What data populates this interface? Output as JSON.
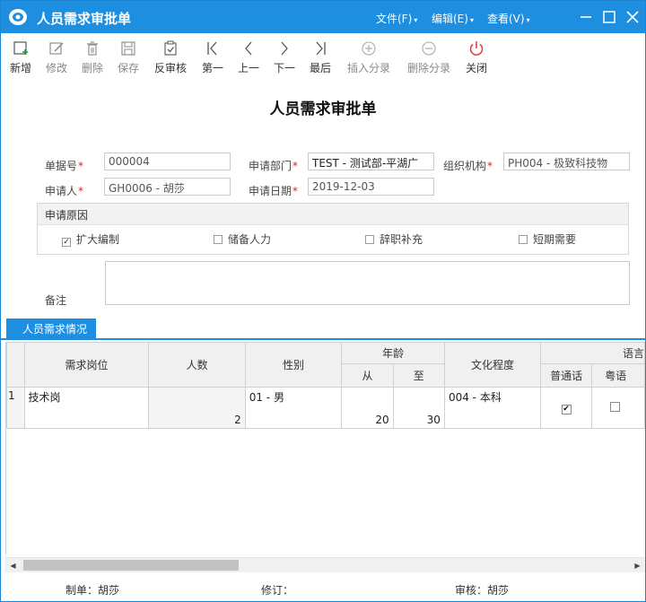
{
  "window": {
    "title": "人员需求审批单",
    "menus": [
      "文件(F)",
      "编辑(E)",
      "查看(V)"
    ],
    "accent_color": "#1e8ee0"
  },
  "toolbar": {
    "buttons": [
      {
        "label": "新增",
        "icon": "add-icon",
        "enabled": true
      },
      {
        "label": "修改",
        "icon": "edit-icon",
        "enabled": false
      },
      {
        "label": "删除",
        "icon": "trash-icon",
        "enabled": false
      },
      {
        "label": "保存",
        "icon": "save-icon",
        "enabled": false
      },
      {
        "label": "反审核",
        "icon": "unaudit-icon",
        "enabled": true
      },
      {
        "label": "第一",
        "icon": "first-icon",
        "enabled": true
      },
      {
        "label": "上一",
        "icon": "prev-icon",
        "enabled": true
      },
      {
        "label": "下一",
        "icon": "next-icon",
        "enabled": true
      },
      {
        "label": "最后",
        "icon": "last-icon",
        "enabled": true
      },
      {
        "label": "插入分录",
        "icon": "plus-circle-icon",
        "enabled": false
      },
      {
        "label": "删除分录",
        "icon": "minus-circle-icon",
        "enabled": false
      },
      {
        "label": "关闭",
        "icon": "power-icon",
        "enabled": true
      }
    ]
  },
  "form": {
    "title": "人员需求审批单",
    "doc_no_label": "单据号",
    "doc_no": "000004",
    "dept_label": "申请部门",
    "dept": "TEST - 测试部-平湖广",
    "org_label": "组织机构",
    "org": "PH004 - 极致科技物",
    "applicant_label": "申请人",
    "applicant": "GH0006 - 胡莎",
    "date_label": "申请日期",
    "date": "2019-12-03",
    "reason_title": "申请原因",
    "reasons": [
      {
        "label": "扩大编制",
        "checked": true
      },
      {
        "label": "储备人力",
        "checked": false
      },
      {
        "label": "辞职补充",
        "checked": false
      },
      {
        "label": "短期需要",
        "checked": false
      }
    ],
    "remark_label": "备注",
    "remark": ""
  },
  "tab": {
    "label": "人员需求情况"
  },
  "grid": {
    "headers": {
      "position": "需求岗位",
      "count": "人数",
      "gender": "性别",
      "age": "年龄",
      "age_from": "从",
      "age_to": "至",
      "education": "文化程度",
      "language": "语言",
      "mandarin": "普通话",
      "cantonese": "粤语"
    },
    "rows": [
      {
        "index": "1",
        "position": "技术岗",
        "count": "2",
        "gender": "01 - 男",
        "age_from": "20",
        "age_to": "30",
        "education": "004 - 本科",
        "mandarin": true,
        "cantonese": false
      }
    ]
  },
  "footer": {
    "maker": "制单：胡莎",
    "revise": "修订：",
    "auditor": "审核：胡莎"
  }
}
